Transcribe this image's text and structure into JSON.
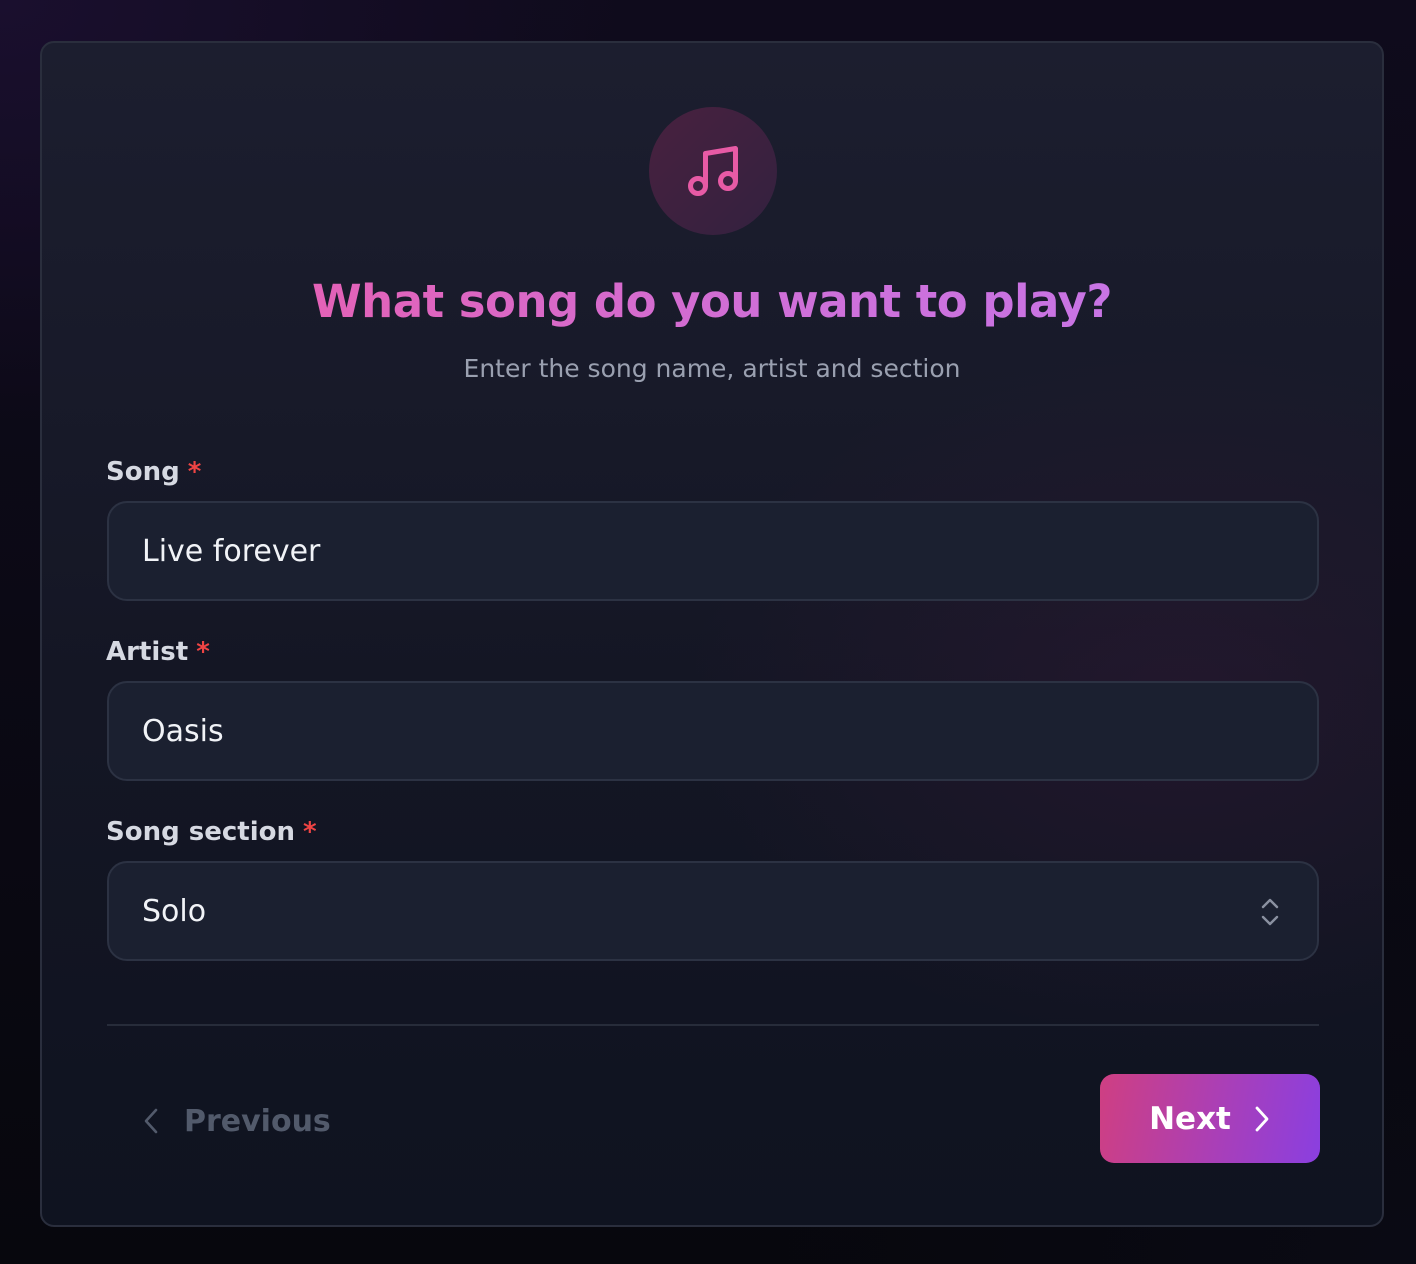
{
  "header": {
    "icon": "music-note-icon",
    "title": "What song do you want to play?",
    "subtitle": "Enter the song name, artist and section"
  },
  "form": {
    "song": {
      "label": "Song",
      "required_marker": "*",
      "value": "Live forever"
    },
    "artist": {
      "label": "Artist",
      "required_marker": "*",
      "value": "Oasis"
    },
    "section": {
      "label": "Song section",
      "required_marker": "*",
      "value": "Solo"
    }
  },
  "nav": {
    "previous_label": "Previous",
    "next_label": "Next"
  },
  "colors": {
    "accent_pink": "#ef5aa4",
    "accent_purple": "#8a3fe0",
    "required": "#ef4444"
  }
}
